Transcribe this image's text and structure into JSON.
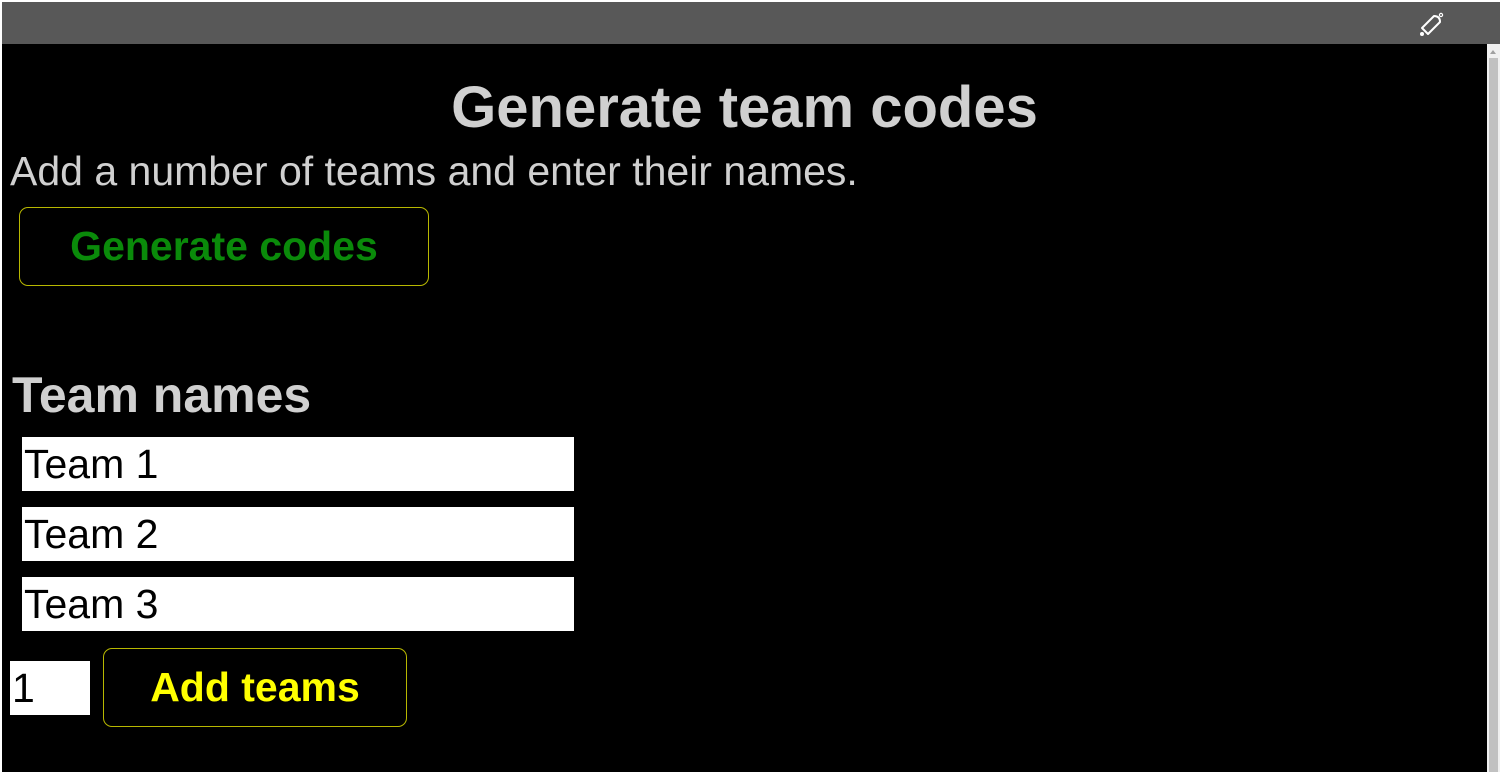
{
  "topbar": {
    "icon": "bell-icon"
  },
  "page": {
    "title": "Generate team codes",
    "subtitle": "Add a number of teams and enter their names.",
    "generate_label": "Generate codes",
    "team_names_heading": "Team names",
    "teams": [
      "Team 1",
      "Team 2",
      "Team 3"
    ],
    "add_count": "1",
    "add_label": "Add teams"
  },
  "colors": {
    "generate": "#0a8a0a",
    "add": "#ffff00",
    "border": "#b8b800"
  }
}
